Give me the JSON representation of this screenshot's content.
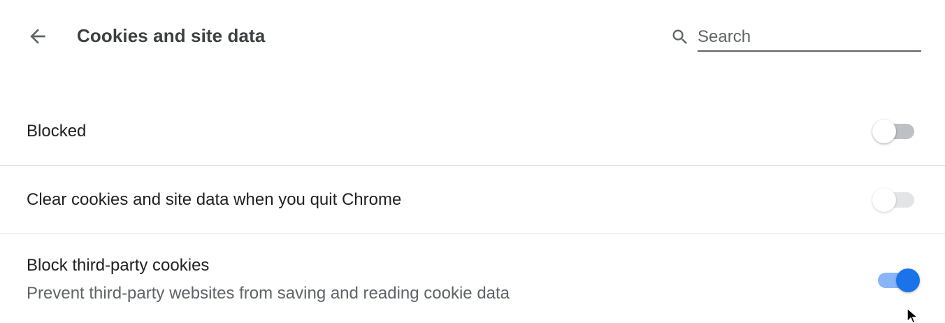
{
  "header": {
    "title": "Cookies and site data",
    "back_icon": "arrow-back-icon",
    "search_icon": "search-icon",
    "search_placeholder": "Search",
    "search_value": ""
  },
  "settings": [
    {
      "label": "Blocked",
      "sublabel": "",
      "enabled": false
    },
    {
      "label": "Clear cookies and site data when you quit Chrome",
      "sublabel": "",
      "enabled": false
    },
    {
      "label": "Block third-party cookies",
      "sublabel": "Prevent third-party websites from saving and reading cookie data",
      "enabled": true
    }
  ],
  "colors": {
    "accent": "#1a73e8",
    "accent_track": "#8ab4f8",
    "text_primary": "#202124",
    "text_secondary": "#5f6368",
    "divider": "#e0e0e0"
  }
}
